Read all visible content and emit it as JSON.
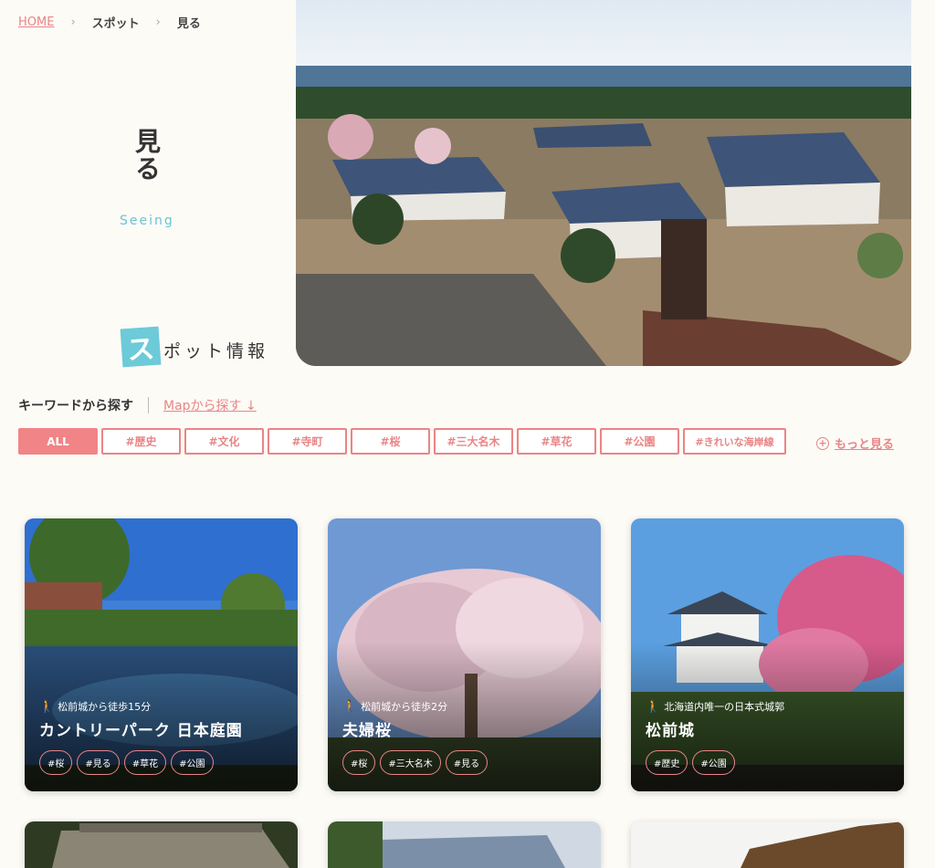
{
  "breadcrumb": {
    "home": "HOME",
    "spot": "スポット",
    "current": "見る"
  },
  "page": {
    "title": "見る",
    "subtitle": "Seeing"
  },
  "logo": {
    "letter": "ス",
    "rest": "ポット情報"
  },
  "search": {
    "keyword_label": "キーワードから探す",
    "map_link": "Mapから探す ↓"
  },
  "tags": [
    "ALL",
    "#歴史",
    "#文化",
    "#寺町",
    "#桜",
    "#三大名木",
    "#草花",
    "#公園",
    "#きれいな海岸線"
  ],
  "more": {
    "icon": "plus-circle-icon",
    "label": "もっと見る"
  },
  "accent_color": "#e98586",
  "cards": [
    {
      "walk": "松前城から徒歩15分",
      "name": "カントリーパーク 日本庭園",
      "tags": [
        "#桜",
        "#見る",
        "#草花",
        "#公園"
      ]
    },
    {
      "walk": "松前城から徒歩2分",
      "name": "夫婦桜",
      "tags": [
        "#桜",
        "#三大名木",
        "#見る"
      ]
    },
    {
      "walk": "北海道内唯一の日本式城郭",
      "name": "松前城",
      "tags": [
        "#歴史",
        "#公園"
      ]
    }
  ]
}
